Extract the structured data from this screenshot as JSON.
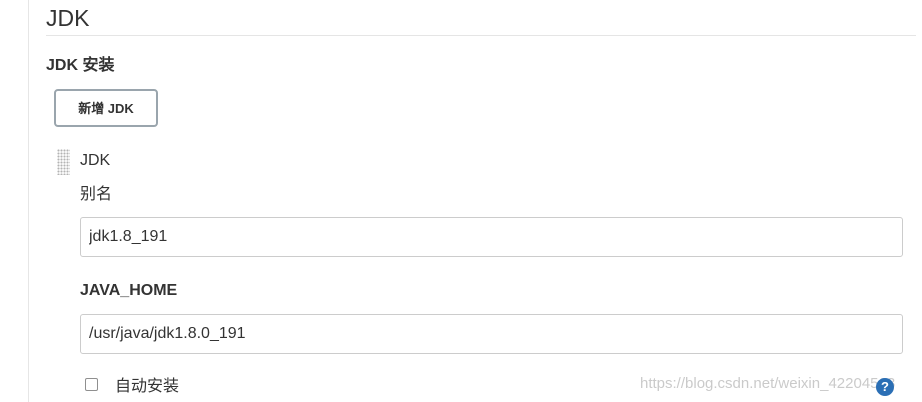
{
  "section": {
    "title": "JDK"
  },
  "installations": {
    "label": "JDK 安装",
    "add_button_label": "新增 JDK"
  },
  "item": {
    "header": "JDK",
    "alias_label": "别名",
    "alias_value": "jdk1.8_191",
    "java_home_label": "JAVA_HOME",
    "java_home_value": "/usr/java/jdk1.8.0_191",
    "auto_install_label": "自动安装",
    "auto_install_checked": false
  },
  "icons": {
    "drag_handle": "drag-handle-icon",
    "help": "help-icon",
    "help_glyph": "?"
  },
  "watermark": "https://blog.csdn.net/weixin_42204563",
  "colors": {
    "help_icon": "#2b6fb5",
    "button_border": "#9aa5ad"
  }
}
